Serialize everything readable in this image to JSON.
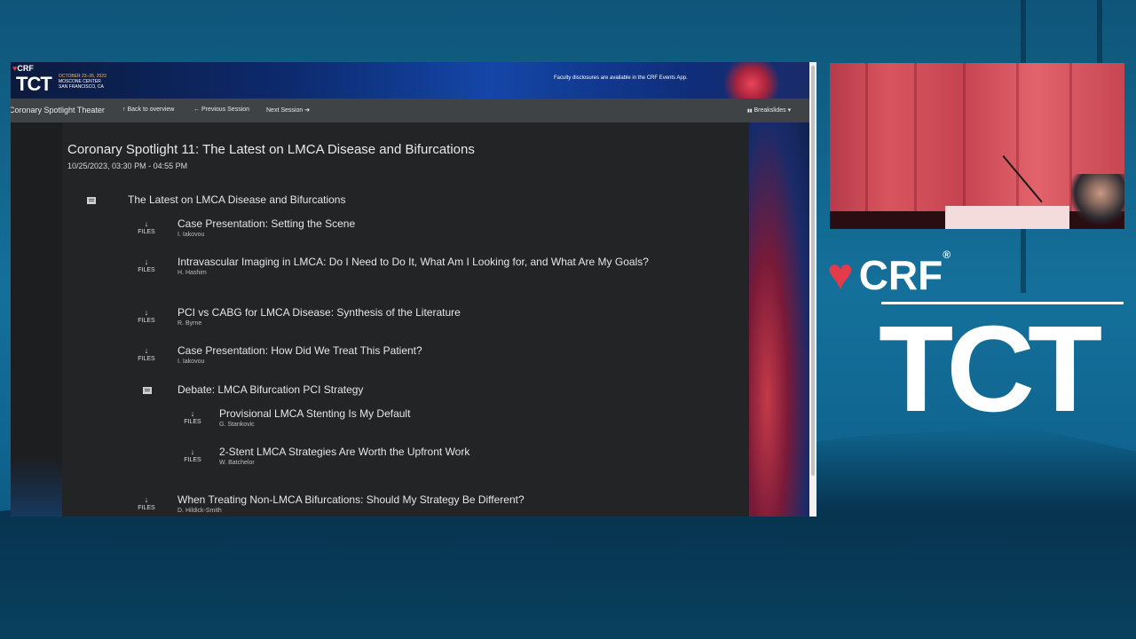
{
  "banner": {
    "crf_logo": "CRF",
    "tct_logo": "TCT",
    "event_dates": "OCTOBER 23–26, 2023",
    "venue": "MOSCONE CENTER",
    "city": "SAN FRANCISCO, CA",
    "disclosure_text": "Faculty disclosures are available in the CRF Events App."
  },
  "navbar": {
    "room": "Coronary Spotlight Theater",
    "back": "Back to overview",
    "previous": "Previous Session",
    "next": "Next Session",
    "breakslides": "Breakslides"
  },
  "session": {
    "title": "Coronary Spotlight 11: The Latest on LMCA Disease and Bifurcations",
    "datetime": "10/25/2023, 03:30 PM - 04:55 PM",
    "group_title": "The Latest on LMCA Disease and Bifurcations",
    "files_label": "FILES",
    "talks": [
      {
        "title": "Case Presentation: Setting the Scene",
        "speaker": "I. Iakovou"
      },
      {
        "title": "Intravascular Imaging in LMCA: Do I Need to Do It, What Am I Looking for, and What Are My Goals?",
        "speaker": "H. Hashim"
      },
      {
        "title": "PCI vs CABG for LMCA Disease: Synthesis of the Literature",
        "speaker": "R. Byrne"
      },
      {
        "title": "Case Presentation: How Did We Treat This Patient?",
        "speaker": "I. Iakovou"
      }
    ],
    "debate": {
      "title": "Debate: LMCA Bifurcation PCI Strategy",
      "talks": [
        {
          "title": "Provisional LMCA Stenting Is My Default",
          "speaker": "G. Stankovic"
        },
        {
          "title": "2-Stent LMCA Strategies Are Worth the Upfront Work",
          "speaker": "W. Batchelor"
        }
      ]
    },
    "last_talk": {
      "title": "When Treating Non-LMCA Bifurcations: Should My Strategy Be Different?",
      "speaker": "D. Hildick-Smith"
    }
  },
  "branding": {
    "crf": "CRF",
    "registered": "®",
    "tct": "TCT"
  },
  "icons": {
    "download": "↓",
    "back": "↑",
    "prev": "←",
    "next": "➔",
    "breakslides": "▮▮",
    "caret": "▾",
    "heart": "♥"
  }
}
